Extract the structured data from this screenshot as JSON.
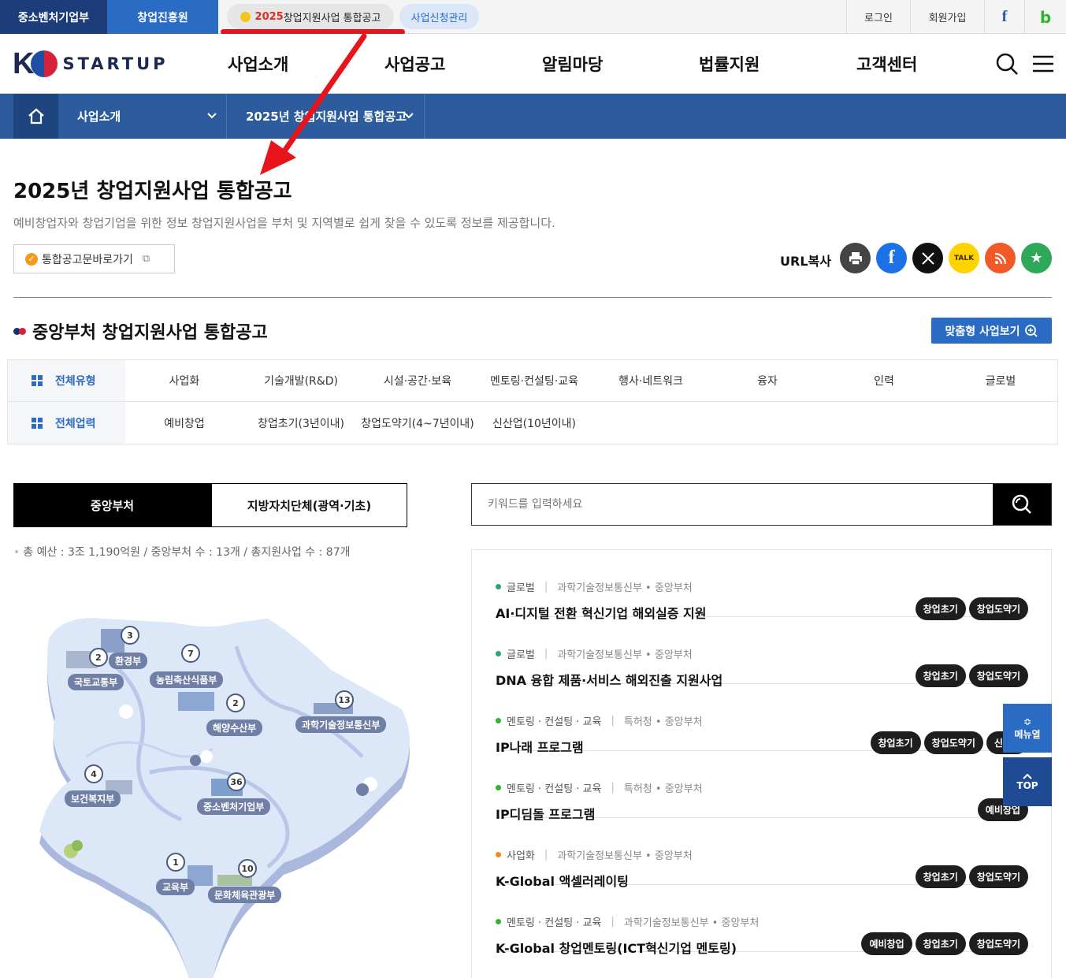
{
  "util_bar": {
    "site1": "중소벤처기업부",
    "site2": "창업진흥원",
    "notice_year": "2025",
    "notice_text": " 창업지원사업 통합공고",
    "apply_manage": "사업신청관리",
    "login": "로그인",
    "signup": "회원가입",
    "facebook": "f",
    "blog": "b"
  },
  "header": {
    "logo_k": "K",
    "logo_text": "STARTUP",
    "nav": [
      "사업소개",
      "사업공고",
      "알림마당",
      "법률지원",
      "고객센터"
    ]
  },
  "breadcrumb": {
    "level1": "사업소개",
    "level2": "2025년 창업지원사업 통합공고"
  },
  "page": {
    "title": "2025년 창업지원사업 통합공고",
    "description": "예비창업자와 창업기업을 위한 정보 창업지원사업을 부처 및 지역별로 쉽게 찾을 수 있도록 정보를 제공합니다.",
    "notice_link": "통합공고문바로가기",
    "url_copy": "URL복사",
    "kakao_label": "TALK"
  },
  "section": {
    "title": "중앙부처 창업지원사업 통합공고",
    "custom_button": "맞춤형 사업보기"
  },
  "filters": {
    "type_header": "전체유형",
    "types": [
      "사업화",
      "기술개발(R&D)",
      "시설·공간·보육",
      "멘토링·컨설팅·교육",
      "행사·네트워크",
      "융자",
      "인력",
      "글로벌"
    ],
    "stage_header": "전체업력",
    "stages": [
      "예비창업",
      "창업초기(3년이내)",
      "창업도약기(4~7년이내)",
      "신산업(10년이내)"
    ]
  },
  "tabs": {
    "central": "중앙부처",
    "local": "지방자치단체(광역·기초)"
  },
  "summary": "총 예산 : 3조 1,190억원 / 중앙부처 수 : 13개 / 총지원사업 수 : 87개",
  "search": {
    "placeholder": "키워드를 입력하세요"
  },
  "map": {
    "ministries": [
      {
        "name": "국토교통부",
        "count": "2"
      },
      {
        "name": "환경부",
        "count": "3"
      },
      {
        "name": "농림축산식품부",
        "count": "7"
      },
      {
        "name": "해양수산부",
        "count": "2"
      },
      {
        "name": "과학기술정보통신부",
        "count": "13"
      },
      {
        "name": "보건복지부",
        "count": "4"
      },
      {
        "name": "중소벤처기업부",
        "count": "36"
      },
      {
        "name": "교육부",
        "count": "1"
      },
      {
        "name": "문화체육관광부",
        "count": "10"
      }
    ]
  },
  "programs": [
    {
      "category": "글로벌",
      "dot": "#2aa37a",
      "org": "과학기술정보통신부 • 중앙부처",
      "name": "AI·디지털 전환 혁신기업 해외실증 지원",
      "tags": [
        "창업초기",
        "창업도약기"
      ]
    },
    {
      "category": "글로벌",
      "dot": "#2aa37a",
      "org": "과학기술정보통신부 • 중앙부처",
      "name": "DNA 융합 제품·서비스 해외진출 지원사업",
      "tags": [
        "창업초기",
        "창업도약기"
      ]
    },
    {
      "category": "멘토링 · 컨설팅 · 교육",
      "dot": "#2db52d",
      "org": "특허청 • 중앙부처",
      "name": "IP나래 프로그램",
      "tags": [
        "창업초기",
        "창업도약기",
        "신산업"
      ]
    },
    {
      "category": "멘토링 · 컨설팅 · 교육",
      "dot": "#2db52d",
      "org": "특허청 • 중앙부처",
      "name": "IP디딤돌 프로그램",
      "tags": [
        "예비창업"
      ]
    },
    {
      "category": "사업화",
      "dot": "#f08a1d",
      "org": "과학기술정보통신부 • 중앙부처",
      "name": "K-Global 액셀러레이팅",
      "tags": [
        "창업초기",
        "창업도약기"
      ]
    },
    {
      "category": "멘토링 · 컨설팅 · 교육",
      "dot": "#2db52d",
      "org": "과학기술정보통신부 • 중앙부처",
      "name": "K-Global 창업멘토링(ICT혁신기업 멘토링)",
      "tags": [
        "예비창업",
        "창업초기",
        "창업도약기"
      ]
    }
  ],
  "floating": {
    "menu": "메뉴열",
    "top": "TOP"
  },
  "colors": {
    "brand_blue": "#2a6bc4",
    "navy": "#1c3d7a",
    "annotation_red": "#e8141b"
  }
}
